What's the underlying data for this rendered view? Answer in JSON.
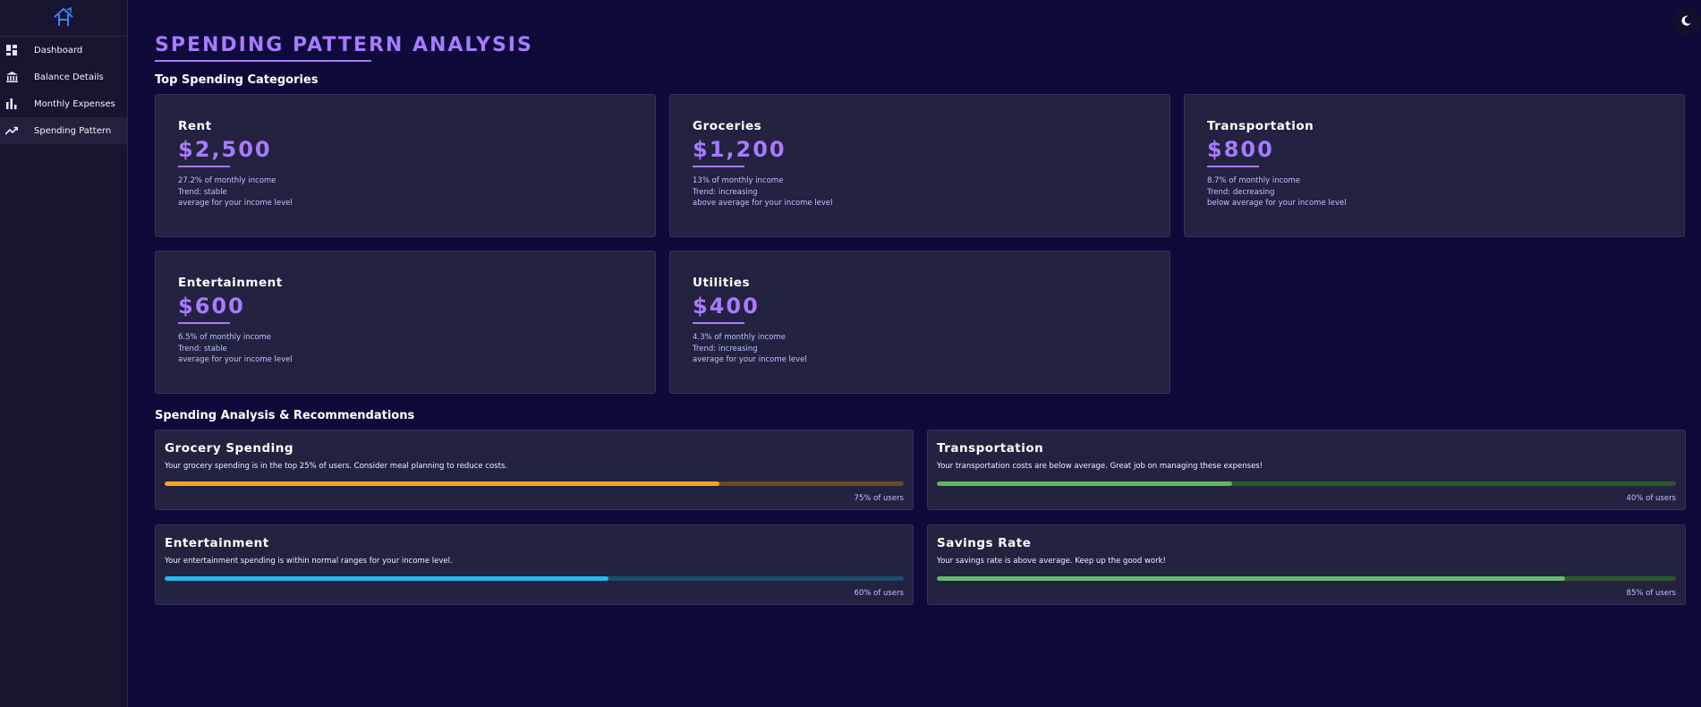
{
  "sidebar": {
    "items": [
      {
        "label": "Dashboard",
        "icon": "dashboard-icon",
        "active": false
      },
      {
        "label": "Balance Details",
        "icon": "bank-icon",
        "active": false
      },
      {
        "label": "Monthly Expenses",
        "icon": "bar-chart-icon",
        "active": false
      },
      {
        "label": "Spending Pattern",
        "icon": "trending-up-icon",
        "active": true
      }
    ]
  },
  "page": {
    "title": "SPENDING PATTERN ANALYSIS",
    "top_categories_heading": "Top Spending Categories",
    "recommendations_heading": "Spending Analysis & Recommendations"
  },
  "categories": [
    {
      "name": "Rent",
      "amount": "$2,500",
      "percent": "27.2% of monthly income",
      "trend": "Trend: stable",
      "comparison": "average for your income level"
    },
    {
      "name": "Groceries",
      "amount": "$1,200",
      "percent": "13% of monthly income",
      "trend": "Trend: increasing",
      "comparison": "above average for your income level"
    },
    {
      "name": "Transportation",
      "amount": "$800",
      "percent": "8.7% of monthly income",
      "trend": "Trend: decreasing",
      "comparison": "below average for your income level"
    },
    {
      "name": "Entertainment",
      "amount": "$600",
      "percent": "6.5% of monthly income",
      "trend": "Trend: stable",
      "comparison": "average for your income level"
    },
    {
      "name": "Utilities",
      "amount": "$400",
      "percent": "4.3% of monthly income",
      "trend": "Trend: increasing",
      "comparison": "average for your income level"
    }
  ],
  "recommendations": [
    {
      "title": "Grocery Spending",
      "description": "Your grocery spending is in the top 25% of users. Consider meal planning to reduce costs.",
      "progress": 0.75,
      "stat": "75% of users",
      "color": "#f5a623",
      "track": "#6b4a1a"
    },
    {
      "title": "Transportation",
      "description": "Your transportation costs are below average. Great job on managing these expenses!",
      "progress": 0.4,
      "stat": "40% of users",
      "color": "#5cb85c",
      "track": "#2c5a2c"
    },
    {
      "title": "Entertainment",
      "description": "Your entertainment spending is within normal ranges for your income level.",
      "progress": 0.6,
      "stat": "60% of users",
      "color": "#29b6f6",
      "track": "#1a4f6e"
    },
    {
      "title": "Savings Rate",
      "description": "Your savings rate is above average. Keep up the good work!",
      "progress": 0.85,
      "stat": "85% of users",
      "color": "#66bb6a",
      "track": "#2c5a2c"
    }
  ],
  "colors": {
    "background": "#0e0a3a",
    "accent": "#a77bff",
    "card": "#232240"
  }
}
